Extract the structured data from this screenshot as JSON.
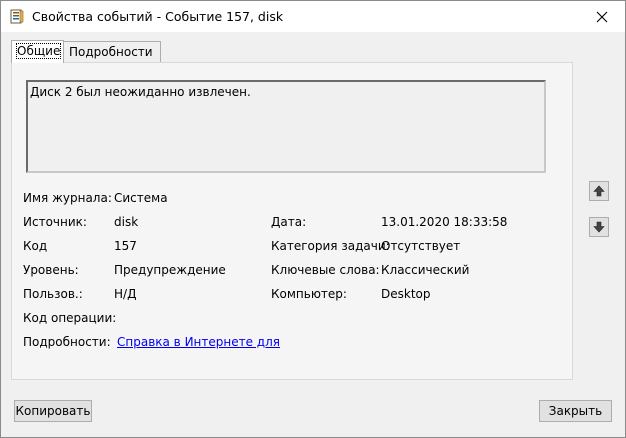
{
  "window": {
    "title": "Свойства событий - Событие 157, disk"
  },
  "tabs": [
    {
      "label": "Общие",
      "active": true
    },
    {
      "label": "Подробности",
      "active": false
    }
  ],
  "message": "Диск 2 был неожиданно извлечен.",
  "fields": {
    "log_name_label": "Имя журнала:",
    "log_name": "Система",
    "source_label": "Источник:",
    "source": "disk",
    "date_label": "Дата:",
    "date": "13.01.2020 18:33:58",
    "code_label": "Код",
    "code": "157",
    "task_category_label": "Категория задачи:",
    "task_category": "Отсутствует",
    "level_label": "Уровень:",
    "level": "Предупреждение",
    "keywords_label": "Ключевые слова:",
    "keywords": "Классический",
    "user_label": "Пользов.:",
    "user": "Н/Д",
    "computer_label": "Компьютер:",
    "computer": "Desktop",
    "opcode_label": "Код операции:",
    "opcode": "",
    "details_label": "Подробности:",
    "details_link": "Справка в Интернете для"
  },
  "buttons": {
    "copy": "Копировать",
    "close": "Закрыть"
  },
  "icons": {
    "app": "event-viewer-icon",
    "close": "close-icon",
    "up": "arrow-up-icon",
    "down": "arrow-down-icon"
  }
}
